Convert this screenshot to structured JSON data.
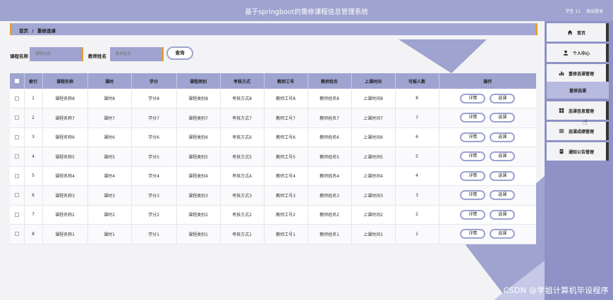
{
  "header": {
    "title": "基于springboot的需修课程信息管理系统",
    "role": "学生 11",
    "logout": "退出登录"
  },
  "breadcrumb": {
    "home": "首页",
    "separator": "/",
    "current": "重修选课"
  },
  "search": {
    "course_label": "课程名称",
    "course_placeholder": "课程名称",
    "teacher_label": "教师姓名",
    "teacher_placeholder": "教师姓名",
    "button": "查询"
  },
  "table": {
    "headers": [
      "索引",
      "课程名称",
      "课时",
      "学分",
      "课程类别",
      "考核方式",
      "教师工号",
      "教师姓名",
      "上课时间",
      "可报人数",
      "操作"
    ],
    "detail_label": "详情",
    "select_label": "选课",
    "rows": [
      {
        "index": "1",
        "name": "课程名称8",
        "hours": "课时8",
        "credit": "学分8",
        "category": "课程类别8",
        "exam": "考核方式8",
        "tid": "教师工号8",
        "tname": "教师姓名8",
        "time": "上课时间8",
        "quota": "8"
      },
      {
        "index": "2",
        "name": "课程名称7",
        "hours": "课时7",
        "credit": "学分7",
        "category": "课程类别7",
        "exam": "考核方式7",
        "tid": "教师工号7",
        "tname": "教师姓名7",
        "time": "上课时间7",
        "quota": "7"
      },
      {
        "index": "3",
        "name": "课程名称6",
        "hours": "课时6",
        "credit": "学分6",
        "category": "课程类别6",
        "exam": "考核方式6",
        "tid": "教师工号6",
        "tname": "教师姓名6",
        "time": "上课时间6",
        "quota": "6"
      },
      {
        "index": "4",
        "name": "课程名称5",
        "hours": "课时5",
        "credit": "学分5",
        "category": "课程类别5",
        "exam": "考核方式5",
        "tid": "教师工号5",
        "tname": "教师姓名5",
        "time": "上课时间5",
        "quota": "5"
      },
      {
        "index": "5",
        "name": "课程名称4",
        "hours": "课时4",
        "credit": "学分4",
        "category": "课程类别4",
        "exam": "考核方式4",
        "tid": "教师工号4",
        "tname": "教师姓名4",
        "time": "上课时间4",
        "quota": "4"
      },
      {
        "index": "6",
        "name": "课程名称3",
        "hours": "课时3",
        "credit": "学分3",
        "category": "课程类别3",
        "exam": "考核方式3",
        "tid": "教师工号3",
        "tname": "教师姓名3",
        "time": "上课时间3",
        "quota": "3"
      },
      {
        "index": "7",
        "name": "课程名称2",
        "hours": "课时2",
        "credit": "学分2",
        "category": "课程类别2",
        "exam": "考核方式2",
        "tid": "教师工号2",
        "tname": "教师姓名2",
        "time": "上课时间2",
        "quota": "2"
      },
      {
        "index": "8",
        "name": "课程名称1",
        "hours": "课时1",
        "credit": "学分1",
        "category": "课程类别1",
        "exam": "考核方式1",
        "tid": "教师工号1",
        "tname": "教师姓名1",
        "time": "上课时间1",
        "quota": "1"
      }
    ]
  },
  "sidebar": {
    "items": [
      {
        "label": "首页",
        "icon": "home-icon"
      },
      {
        "label": "个人中心",
        "icon": "user-icon"
      },
      {
        "label": "重修选课管理",
        "icon": "bar-chart-icon"
      },
      {
        "label": "重修选课",
        "icon": ""
      },
      {
        "label": "选课信息管理",
        "icon": "grid-icon"
      },
      {
        "label": "选课成绩管理",
        "icon": "list-icon"
      },
      {
        "label": "通知公告管理",
        "icon": "notice-icon"
      }
    ]
  },
  "watermark": "CSDN @学姐计算机毕设程序",
  "colors": {
    "primary": "#9ea3cf",
    "accent": "#e0a030",
    "sidebar": "#8e92c6"
  }
}
